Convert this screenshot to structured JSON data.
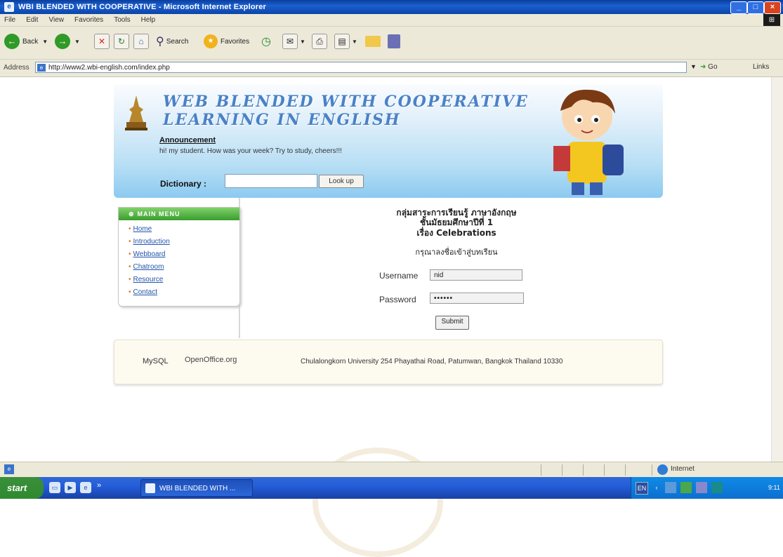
{
  "window": {
    "title": "WBI BLENDED WITH COOPERATIVE - Microsoft Internet Explorer",
    "min": "_",
    "max": "□",
    "close": "×"
  },
  "menu": [
    "File",
    "Edit",
    "View",
    "Favorites",
    "Tools",
    "Help"
  ],
  "toolbar": {
    "back": "Back",
    "search": "Search",
    "favorites": "Favorites"
  },
  "address": {
    "label": "Address",
    "url": "http://www2.wbi-english.com/index.php",
    "go": "Go",
    "links": "Links"
  },
  "header": {
    "title_line1": "WEB BLENDED WITH COOPERATIVE",
    "title_line2": "LEARNING IN ENGLISH",
    "announcement_heading": "Announcement",
    "announcement_text": "hi! my student. How was your week? Try to study, cheers!!!",
    "dictionary_label": "Dictionary :",
    "dictionary_value": "",
    "lookup_label": "Look up"
  },
  "main_menu": {
    "title": "MAIN MENU",
    "items": [
      "Home",
      "Introduction",
      "Webboard",
      "Chatroom",
      "Resource",
      "Contact"
    ]
  },
  "login": {
    "line1": "กลุ่มสาระการเรียนรู้ ภาษาอังกฤษ",
    "line2": "ชั้นมัธยมศึกษาปีที่ 1",
    "line3": "เรื่อง Celebrations",
    "prompt": "กรุณาลงชื่อเข้าสู่บทเรียน",
    "username_label": "Username",
    "username_value": "nid",
    "password_label": "Password",
    "password_value": "••••••",
    "submit_label": "Submit"
  },
  "footer": {
    "mysql": "MySQL",
    "openoffice": "OpenOffice.org",
    "address": "Chulalongkorn University 254 Phayathai Road, Patumwan, Bangkok Thailand 10330"
  },
  "status": {
    "zone": "Internet"
  },
  "taskbar": {
    "start": "start",
    "task_label": "WBI BLENDED WITH ...",
    "language": "EN",
    "clock": "9:11"
  }
}
